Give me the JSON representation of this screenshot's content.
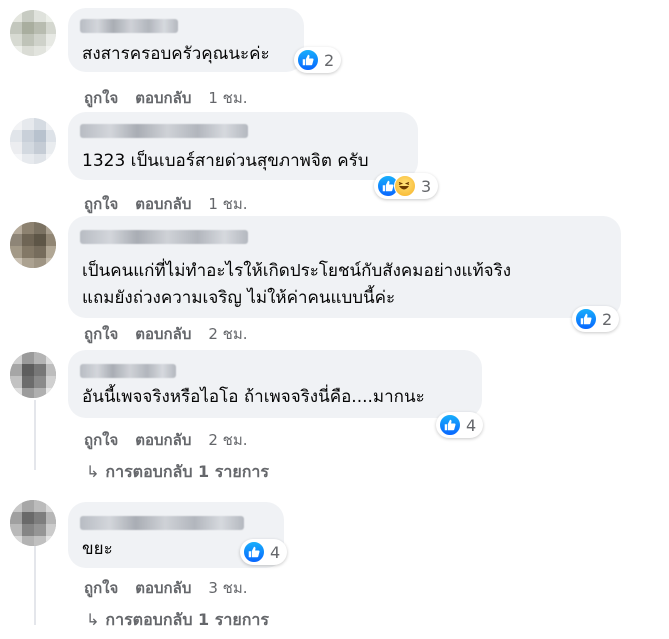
{
  "colors": {
    "bubble": "#f0f2f5",
    "action_text": "#65676b",
    "like_blue": "#0866ff",
    "haha_yellow": "#f7b125"
  },
  "actions": {
    "like": "ถูกใจ",
    "reply": "ตอบกลับ"
  },
  "comments": [
    {
      "text": [
        "สงสารครอบครัวคุณนะค่ะ"
      ],
      "time": "1 ชม.",
      "reactions": [
        "like-icon"
      ],
      "reaction_count": "2"
    },
    {
      "text": [
        "1323 เป็นเบอร์สายด่วนสุขภาพจิต ครับ"
      ],
      "time": "1 ชม.",
      "reactions": [
        "like-icon",
        "haha-icon"
      ],
      "reaction_count": "3"
    },
    {
      "text": [
        "เป็นคนแก่ที่ไม่ทำอะไรให้เกิดประโยชน์กับสังคมอย่างแท้จริง",
        "แถมยังถ่วงความเจริญ ไม่ให้ค่าคนแบบนี้ค่ะ"
      ],
      "time": "2 ชม.",
      "reactions": [
        "like-icon"
      ],
      "reaction_count": "2"
    },
    {
      "text": [
        "อันนี้เพจจริงหรือไอโอ ถ้าเพจจริงนี่คือ....มากนะ"
      ],
      "time": "2 ชม.",
      "reactions": [
        "like-icon"
      ],
      "reaction_count": "4",
      "replies_label": "การตอบกลับ 1 รายการ"
    },
    {
      "text": [
        "ขยะ"
      ],
      "time": "3 ชม.",
      "reactions": [
        "like-icon"
      ],
      "reaction_count": "4",
      "replies_label": "การตอบกลับ 1 รายการ"
    }
  ]
}
